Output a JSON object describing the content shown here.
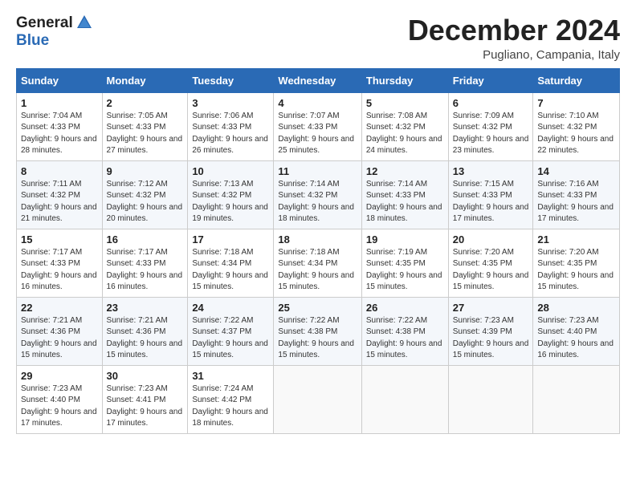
{
  "header": {
    "logo_general": "General",
    "logo_blue": "Blue",
    "month_title": "December 2024",
    "location": "Pugliano, Campania, Italy"
  },
  "days_of_week": [
    "Sunday",
    "Monday",
    "Tuesday",
    "Wednesday",
    "Thursday",
    "Friday",
    "Saturday"
  ],
  "weeks": [
    [
      {
        "day": "1",
        "sunrise": "7:04 AM",
        "sunset": "4:33 PM",
        "daylight": "9 hours and 28 minutes."
      },
      {
        "day": "2",
        "sunrise": "7:05 AM",
        "sunset": "4:33 PM",
        "daylight": "9 hours and 27 minutes."
      },
      {
        "day": "3",
        "sunrise": "7:06 AM",
        "sunset": "4:33 PM",
        "daylight": "9 hours and 26 minutes."
      },
      {
        "day": "4",
        "sunrise": "7:07 AM",
        "sunset": "4:33 PM",
        "daylight": "9 hours and 25 minutes."
      },
      {
        "day": "5",
        "sunrise": "7:08 AM",
        "sunset": "4:32 PM",
        "daylight": "9 hours and 24 minutes."
      },
      {
        "day": "6",
        "sunrise": "7:09 AM",
        "sunset": "4:32 PM",
        "daylight": "9 hours and 23 minutes."
      },
      {
        "day": "7",
        "sunrise": "7:10 AM",
        "sunset": "4:32 PM",
        "daylight": "9 hours and 22 minutes."
      }
    ],
    [
      {
        "day": "8",
        "sunrise": "7:11 AM",
        "sunset": "4:32 PM",
        "daylight": "9 hours and 21 minutes."
      },
      {
        "day": "9",
        "sunrise": "7:12 AM",
        "sunset": "4:32 PM",
        "daylight": "9 hours and 20 minutes."
      },
      {
        "day": "10",
        "sunrise": "7:13 AM",
        "sunset": "4:32 PM",
        "daylight": "9 hours and 19 minutes."
      },
      {
        "day": "11",
        "sunrise": "7:14 AM",
        "sunset": "4:32 PM",
        "daylight": "9 hours and 18 minutes."
      },
      {
        "day": "12",
        "sunrise": "7:14 AM",
        "sunset": "4:33 PM",
        "daylight": "9 hours and 18 minutes."
      },
      {
        "day": "13",
        "sunrise": "7:15 AM",
        "sunset": "4:33 PM",
        "daylight": "9 hours and 17 minutes."
      },
      {
        "day": "14",
        "sunrise": "7:16 AM",
        "sunset": "4:33 PM",
        "daylight": "9 hours and 17 minutes."
      }
    ],
    [
      {
        "day": "15",
        "sunrise": "7:17 AM",
        "sunset": "4:33 PM",
        "daylight": "9 hours and 16 minutes."
      },
      {
        "day": "16",
        "sunrise": "7:17 AM",
        "sunset": "4:33 PM",
        "daylight": "9 hours and 16 minutes."
      },
      {
        "day": "17",
        "sunrise": "7:18 AM",
        "sunset": "4:34 PM",
        "daylight": "9 hours and 15 minutes."
      },
      {
        "day": "18",
        "sunrise": "7:18 AM",
        "sunset": "4:34 PM",
        "daylight": "9 hours and 15 minutes."
      },
      {
        "day": "19",
        "sunrise": "7:19 AM",
        "sunset": "4:35 PM",
        "daylight": "9 hours and 15 minutes."
      },
      {
        "day": "20",
        "sunrise": "7:20 AM",
        "sunset": "4:35 PM",
        "daylight": "9 hours and 15 minutes."
      },
      {
        "day": "21",
        "sunrise": "7:20 AM",
        "sunset": "4:35 PM",
        "daylight": "9 hours and 15 minutes."
      }
    ],
    [
      {
        "day": "22",
        "sunrise": "7:21 AM",
        "sunset": "4:36 PM",
        "daylight": "9 hours and 15 minutes."
      },
      {
        "day": "23",
        "sunrise": "7:21 AM",
        "sunset": "4:36 PM",
        "daylight": "9 hours and 15 minutes."
      },
      {
        "day": "24",
        "sunrise": "7:22 AM",
        "sunset": "4:37 PM",
        "daylight": "9 hours and 15 minutes."
      },
      {
        "day": "25",
        "sunrise": "7:22 AM",
        "sunset": "4:38 PM",
        "daylight": "9 hours and 15 minutes."
      },
      {
        "day": "26",
        "sunrise": "7:22 AM",
        "sunset": "4:38 PM",
        "daylight": "9 hours and 15 minutes."
      },
      {
        "day": "27",
        "sunrise": "7:23 AM",
        "sunset": "4:39 PM",
        "daylight": "9 hours and 15 minutes."
      },
      {
        "day": "28",
        "sunrise": "7:23 AM",
        "sunset": "4:40 PM",
        "daylight": "9 hours and 16 minutes."
      }
    ],
    [
      {
        "day": "29",
        "sunrise": "7:23 AM",
        "sunset": "4:40 PM",
        "daylight": "9 hours and 17 minutes."
      },
      {
        "day": "30",
        "sunrise": "7:23 AM",
        "sunset": "4:41 PM",
        "daylight": "9 hours and 17 minutes."
      },
      {
        "day": "31",
        "sunrise": "7:24 AM",
        "sunset": "4:42 PM",
        "daylight": "9 hours and 18 minutes."
      },
      null,
      null,
      null,
      null
    ]
  ]
}
